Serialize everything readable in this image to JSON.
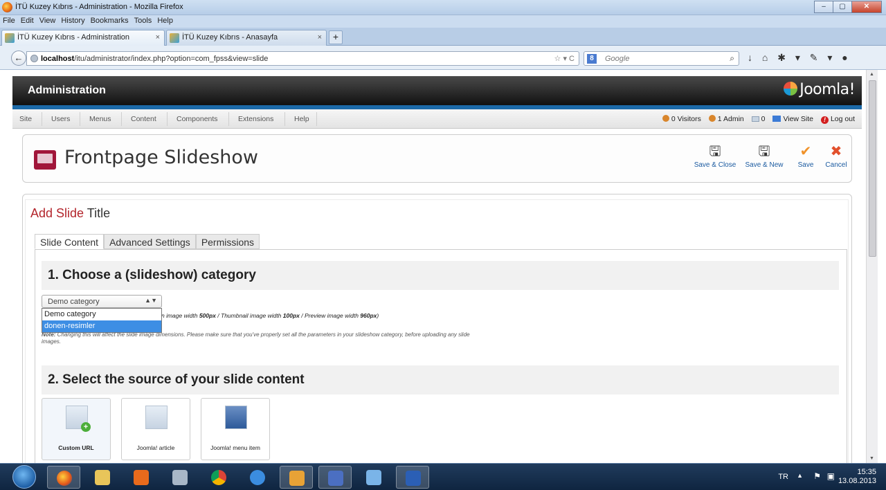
{
  "window": {
    "title": "İTÜ Kuzey Kıbrıs - Administration - Mozilla Firefox",
    "min": "–",
    "max": "▢",
    "close": "✕"
  },
  "menubar": [
    "File",
    "Edit",
    "View",
    "History",
    "Bookmarks",
    "Tools",
    "Help"
  ],
  "tabs": [
    {
      "label": "İTÜ Kuzey Kıbrıs - Administration",
      "close": "×"
    },
    {
      "label": "İTÜ Kuzey Kıbrıs - Anasayfa",
      "close": "×"
    }
  ],
  "newtab": "+",
  "address": {
    "host": "localhost",
    "path": "/itu/administrator/index.php?option=com_fpss&view=slide",
    "right_icons": "☆ ▾ C"
  },
  "search": {
    "engine": "8",
    "placeholder": "Google",
    "icon": "⌕"
  },
  "nav_icons": "↓ ⌂ ✱ ▾ ✎ ▾ ●",
  "joomla": {
    "header_title": "Administration",
    "logo_text": "Joomla!",
    "menu": [
      "Site",
      "Users",
      "Menus",
      "Content",
      "Components",
      "Extensions",
      "Help"
    ],
    "status": {
      "visitors": "0 Visitors",
      "admin": "1 Admin",
      "messages": "0",
      "view_site": "View Site",
      "logout": "Log out"
    }
  },
  "component": {
    "title": "Frontpage Slideshow",
    "buttons": [
      {
        "label": "Save & Close",
        "glyph": "🖫"
      },
      {
        "label": "Save & New",
        "glyph": "🖫"
      },
      {
        "label": "Save",
        "glyph": "✔"
      },
      {
        "label": "Cancel",
        "glyph": "✖"
      }
    ]
  },
  "form": {
    "title_red": "Add Slide",
    "title_rest": "Title",
    "tabs": [
      "Slide Content",
      "Advanced Settings",
      "Permissions"
    ],
    "section1": "1. Choose a (slideshow) category",
    "category_select": {
      "value": "Demo category",
      "options": [
        "Demo category",
        "donen-resimler"
      ],
      "highlighted": "donen-resimler"
    },
    "hint_prefix": "n image width ",
    "hint_main": "500px",
    "hint_mid1": " / Thumbnail image width ",
    "hint_thumb": "100px",
    "hint_mid2": " / Preview image width ",
    "hint_preview": "960px",
    "hint_end": ")",
    "note_label": "Note:",
    "note_text": " Changing this will affect the slide image dimensions. Please make sure that you've properly set all the parameters in your slideshow category, before uploading any slide images.",
    "section2": "2. Select the source of your slide content",
    "sources": [
      "Custom URL",
      "Joomla! article",
      "Joomla! menu item"
    ]
  },
  "taskbar": {
    "lang": "TR",
    "time": "15:35",
    "date": "13.08.2013"
  },
  "colors": {
    "accent_red": "#b3252c",
    "joomla_blue": "#1c6aa8",
    "select_highlight": "#3d8ee4"
  }
}
